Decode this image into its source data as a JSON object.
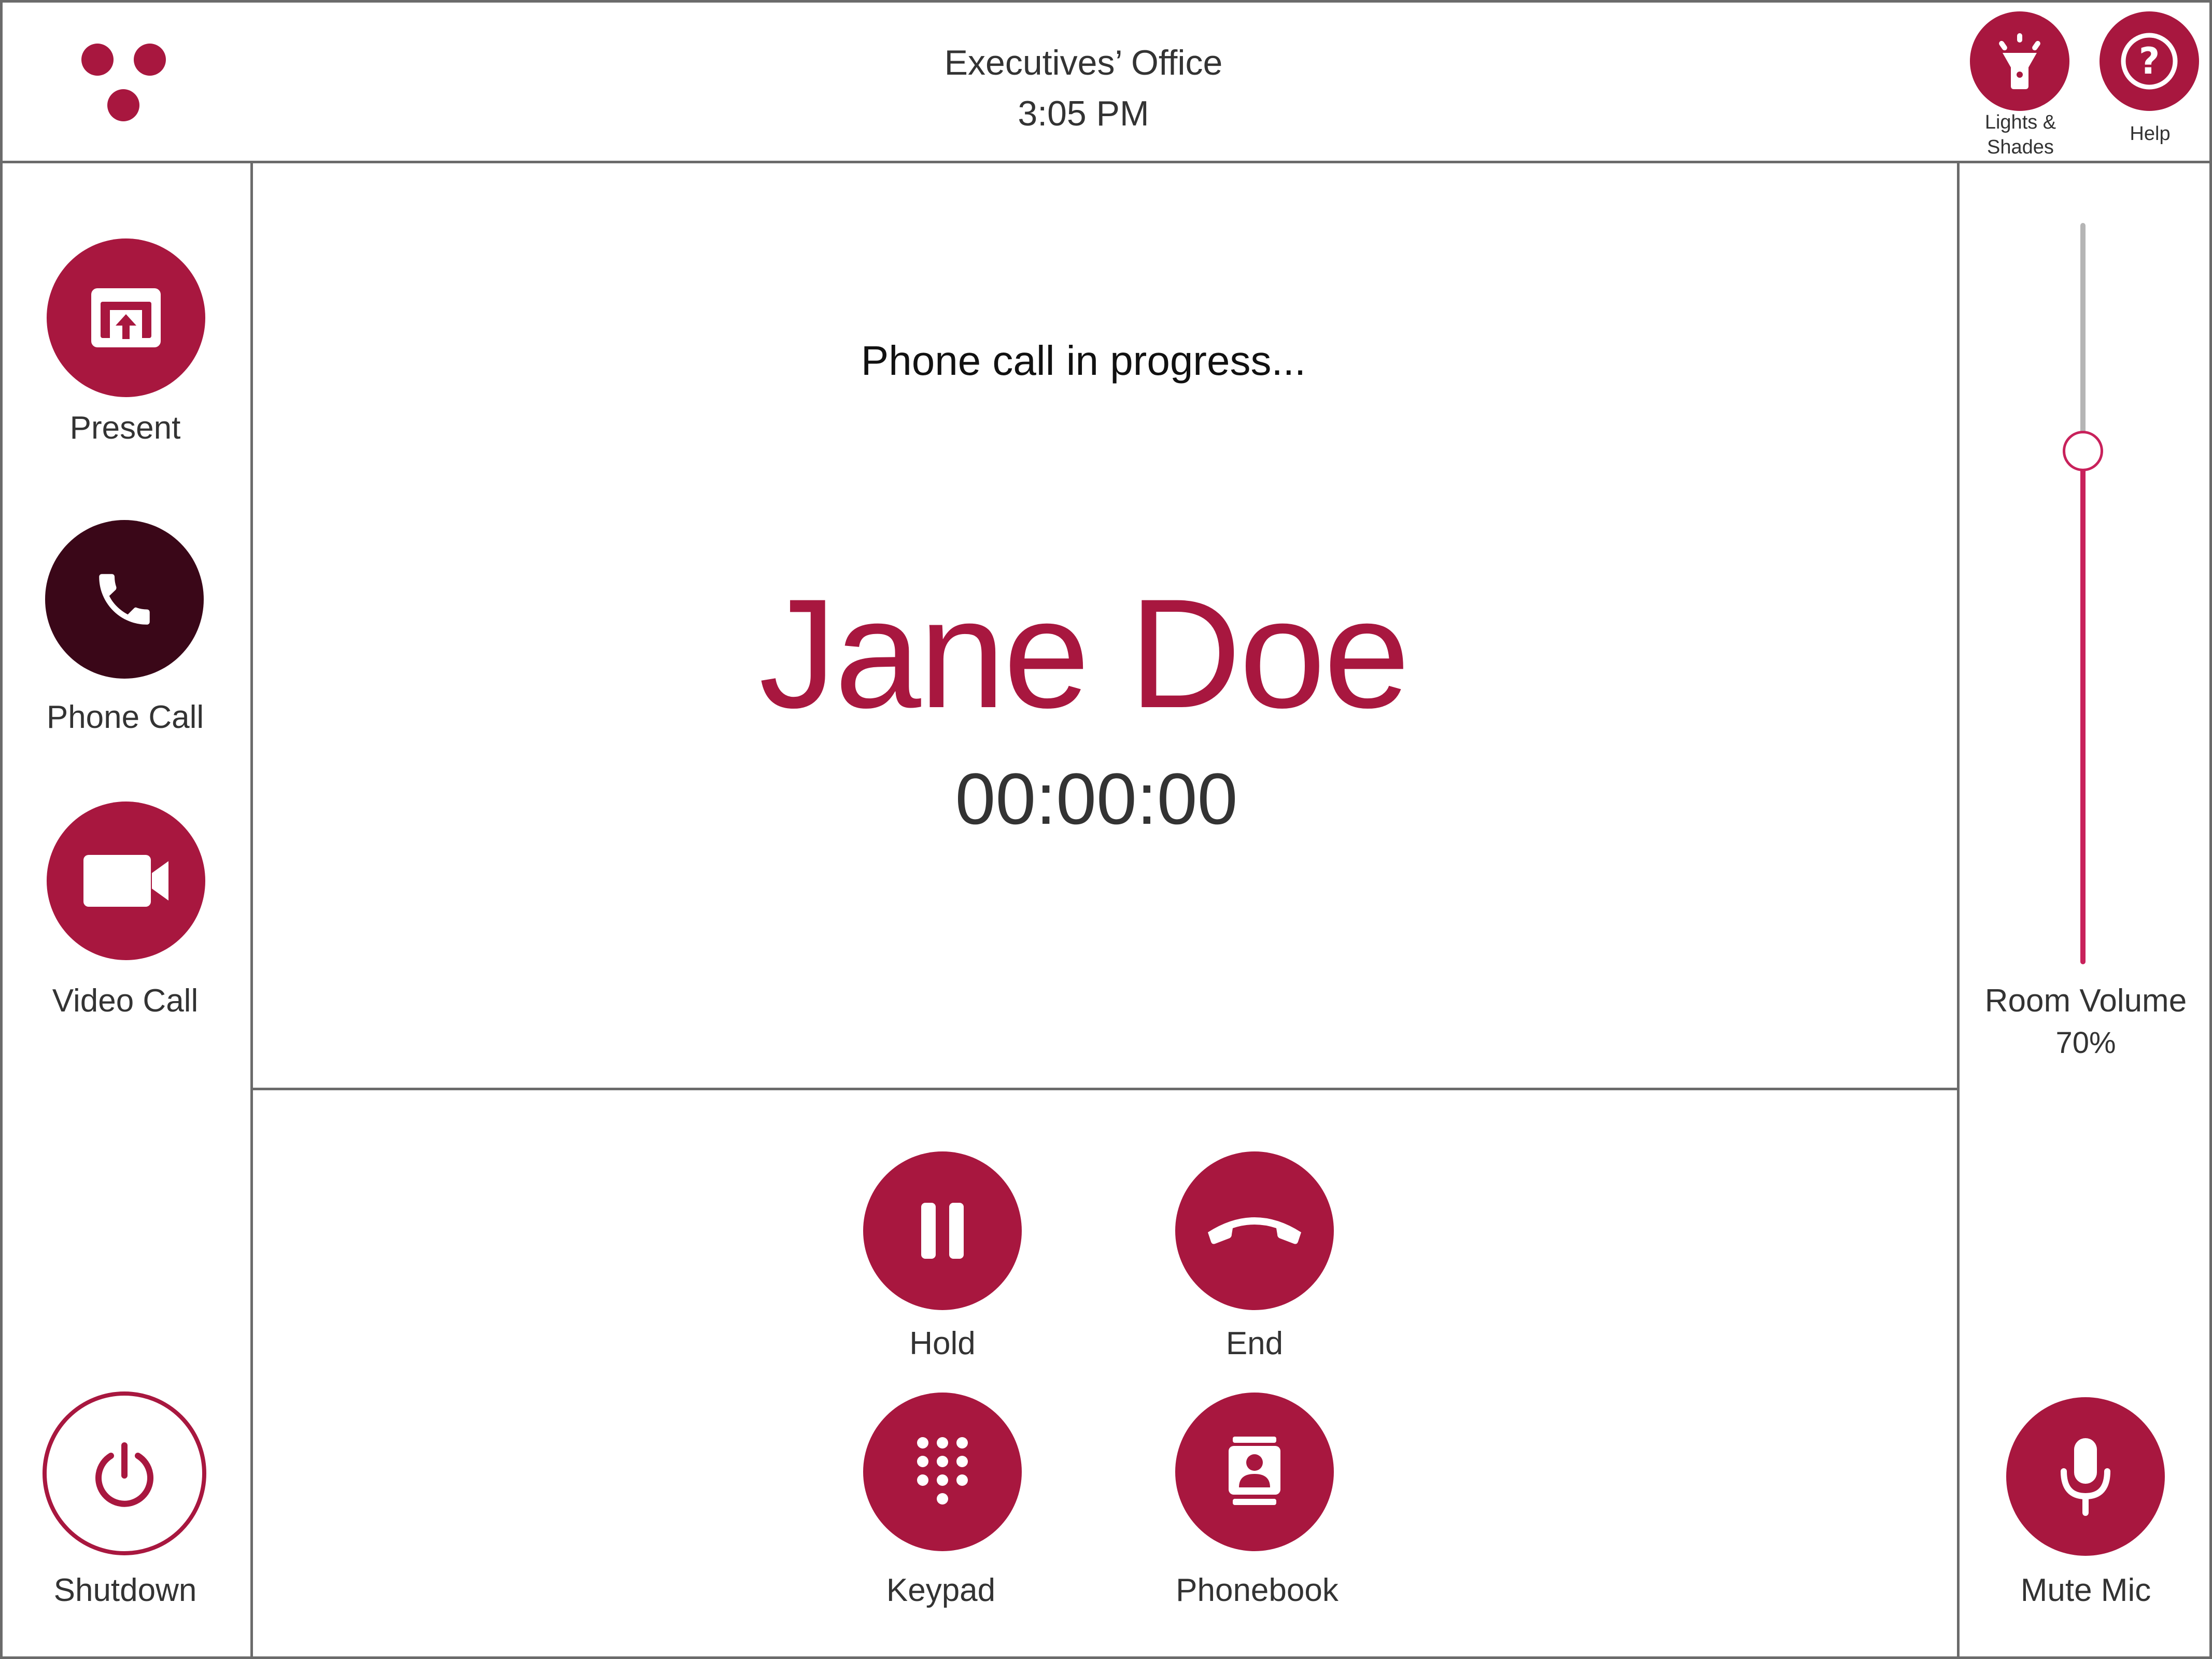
{
  "header": {
    "room": "Executives’ Office",
    "time": "3:05 PM",
    "lights_label_line1": "Lights &",
    "lights_label_line2": "Shades",
    "help_label": "Help"
  },
  "sidebar": {
    "present_label": "Present",
    "phone_label": "Phone Call",
    "video_label": "Video Call",
    "shutdown_label": "Shutdown"
  },
  "call": {
    "status": "Phone call in progress...",
    "caller_name": "Jane Doe",
    "duration": "00:00:00"
  },
  "controls": {
    "hold_label": "Hold",
    "end_label": "End",
    "keypad_label": "Keypad",
    "phonebook_label": "Phonebook"
  },
  "volume": {
    "label": "Room Volume",
    "value_text": "70%",
    "level": 0.7
  },
  "mic": {
    "label": "Mute Mic"
  },
  "colors": {
    "accent": "#a8173f",
    "active": "#3a0718",
    "slider": "#c8215b",
    "border": "#6b6b6b"
  }
}
